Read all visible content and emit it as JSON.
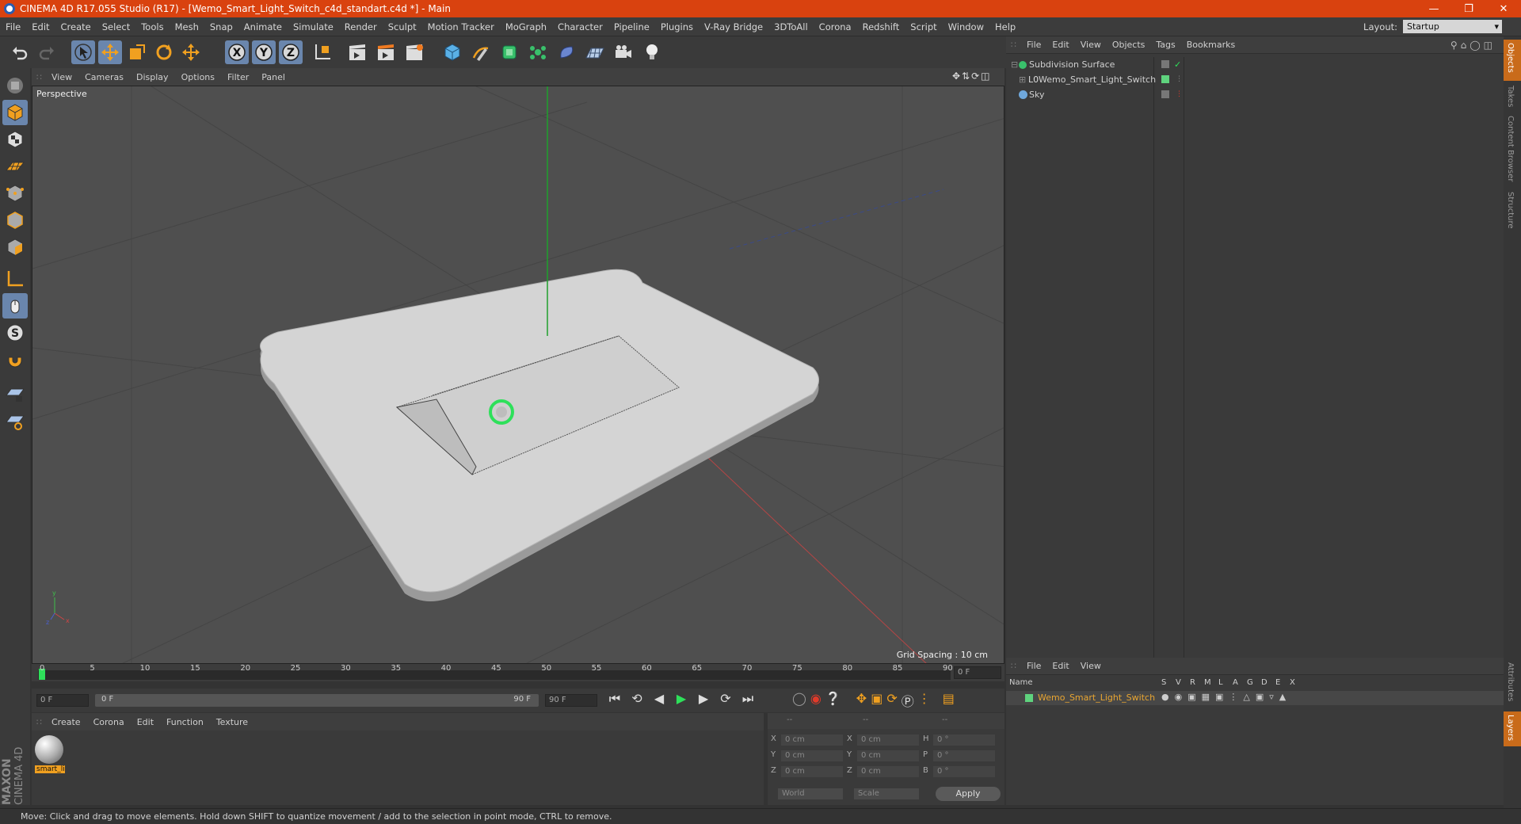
{
  "window": {
    "title": "CINEMA 4D R17.055 Studio (R17) - [Wemo_Smart_Light_Switch_c4d_standart.c4d *] - Main"
  },
  "menu": [
    "File",
    "Edit",
    "Create",
    "Select",
    "Tools",
    "Mesh",
    "Snap",
    "Animate",
    "Simulate",
    "Render",
    "Sculpt",
    "Motion Tracker",
    "MoGraph",
    "Character",
    "Pipeline",
    "Plugins",
    "V-Ray Bridge",
    "3DToAll",
    "Corona",
    "Redshift",
    "Script",
    "Window",
    "Help"
  ],
  "layout": {
    "label": "Layout:",
    "value": "Startup"
  },
  "viewport": {
    "menu": [
      "View",
      "Cameras",
      "Display",
      "Options",
      "Filter",
      "Panel"
    ],
    "camera_label": "Perspective",
    "grid_spacing": "Grid Spacing : 10 cm"
  },
  "timeline": {
    "ticks": [
      "0",
      "5",
      "10",
      "15",
      "20",
      "25",
      "30",
      "35",
      "40",
      "45",
      "50",
      "55",
      "60",
      "65",
      "70",
      "75",
      "80",
      "85",
      "90"
    ],
    "current_frame": "0 F",
    "start_field": "0 F",
    "range_start": "0 F",
    "range_end": "90 F",
    "end_field": "90 F"
  },
  "material_panel": {
    "menu": [
      "Create",
      "Corona",
      "Edit",
      "Function",
      "Texture"
    ],
    "material_name": "smart_li"
  },
  "coords": {
    "headers": [
      "--",
      "--",
      "--"
    ],
    "rows": [
      {
        "a": "X",
        "av": "0 cm",
        "b": "X",
        "bv": "0 cm",
        "c": "H",
        "cv": "0 °"
      },
      {
        "a": "Y",
        "av": "0 cm",
        "b": "Y",
        "bv": "0 cm",
        "c": "P",
        "cv": "0 °"
      },
      {
        "a": "Z",
        "av": "0 cm",
        "b": "Z",
        "bv": "0 cm",
        "c": "B",
        "cv": "0 °"
      }
    ],
    "space": "World",
    "mode": "Scale",
    "apply": "Apply"
  },
  "object_manager": {
    "menu": [
      "File",
      "Edit",
      "View",
      "Objects",
      "Tags",
      "Bookmarks"
    ],
    "objects": [
      {
        "name": "Subdivision Surface"
      },
      {
        "name": "Wemo_Smart_Light_Switch"
      },
      {
        "name": "Sky"
      }
    ]
  },
  "layer_manager": {
    "menu": [
      "File",
      "Edit",
      "View"
    ],
    "columns": [
      "Name",
      "S",
      "V",
      "R",
      "M",
      "L",
      "A",
      "G",
      "D",
      "E",
      "X"
    ],
    "layer_name": "Wemo_Smart_Light_Switch"
  },
  "side_tabs": [
    "Objects",
    "Takes",
    "Content Browser",
    "Structure",
    "Attributes",
    "Layers"
  ],
  "brand": [
    "MAXON",
    "CINEMA 4D"
  ],
  "status": "Move: Click and drag to move elements. Hold down SHIFT to quantize movement / add to the selection in point mode, CTRL to remove.",
  "colors": {
    "titlebar": "#d9420f",
    "selected_tool": "#6a86ad",
    "layer_name": "#e8a531",
    "layer_swatch": "#5fd37e"
  }
}
